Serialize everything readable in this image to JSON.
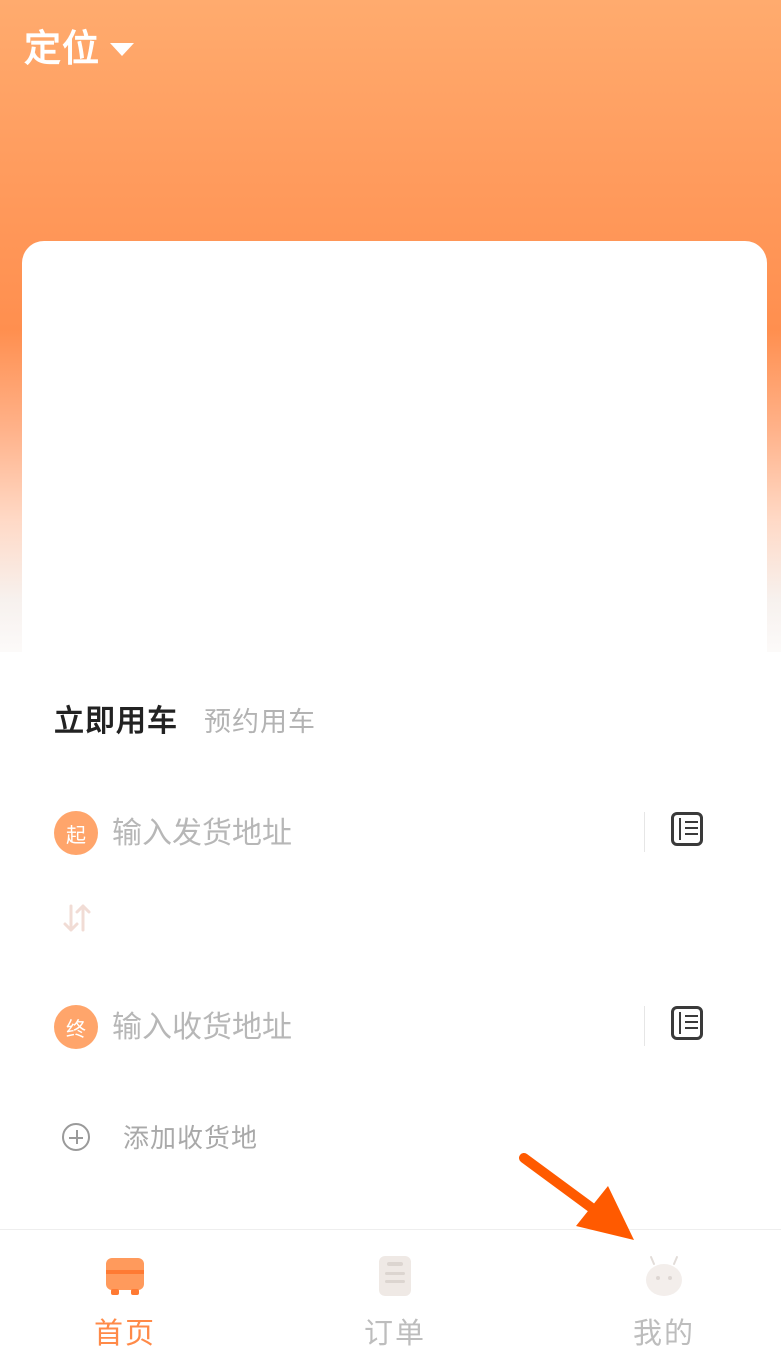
{
  "header": {
    "location_label": "定位"
  },
  "booking": {
    "tab_now": "立即用车",
    "tab_reserve": "预约用车",
    "pickup": {
      "badge": "起",
      "placeholder": "输入发货地址"
    },
    "dropoff": {
      "badge": "终",
      "placeholder": "输入收货地址"
    },
    "add_destination_label": "添加收货地"
  },
  "tabbar": {
    "items": [
      {
        "label": "首页",
        "icon": "truck-icon",
        "active": true
      },
      {
        "label": "订单",
        "icon": "order-icon",
        "active": false
      },
      {
        "label": "我的",
        "icon": "profile-icon",
        "active": false
      }
    ]
  },
  "colors": {
    "accent": "#ff8a48",
    "header_top": "#ffab6e",
    "inactive_tab": "#bdbdbd",
    "annotation_arrow": "#ff5a00"
  }
}
